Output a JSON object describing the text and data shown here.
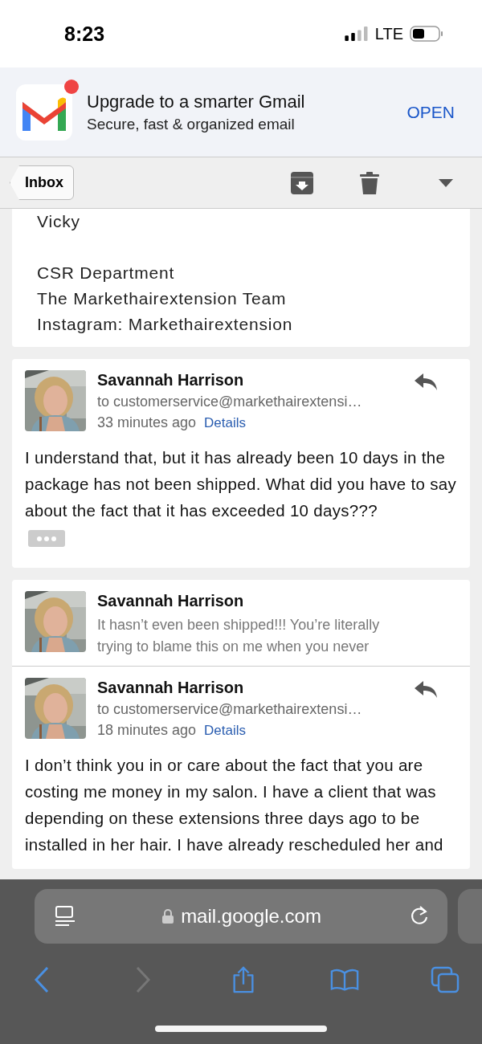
{
  "status_bar": {
    "time": "8:23",
    "network": "LTE"
  },
  "banner": {
    "title": "Upgrade to a smarter Gmail",
    "subtitle": "Secure, fast & organized email",
    "action": "OPEN",
    "notification_dot": true
  },
  "toolbar": {
    "back": "Inbox"
  },
  "signature": {
    "name": "Vicky",
    "lines": [
      "CSR Department",
      "The Markethairextension Team",
      "Instagram: Markethairextension"
    ]
  },
  "cards": [
    {
      "messages": [
        {
          "kind": "expanded",
          "sender": "Savannah Harrison",
          "to": "to customerservice@markethairextensi…",
          "time": "33 minutes ago",
          "details": "Details",
          "body": "I understand that, but it has already been 10 days in the package has not been shipped. What did you have to say about the fact that it has exceeded 10 days???",
          "trimmed": true
        }
      ]
    },
    {
      "messages": [
        {
          "kind": "collapsed",
          "sender": "Savannah Harrison",
          "snippet": "It hasn’t even been shipped!!! You’re literally trying to blame this on me when you never"
        },
        {
          "kind": "expanded",
          "sender": "Savannah Harrison",
          "to": "to customerservice@markethairextensi…",
          "time": "18 minutes ago",
          "details": "Details",
          "body": "I don’t think you in or care about the fact that you are costing me money in my salon. I have a client that was depending on these extensions three days ago to be installed in her hair. I have already rescheduled her and",
          "trimmed": false
        }
      ]
    }
  ],
  "address_bar": {
    "url": "mail.google.com"
  },
  "nav_buttons": [
    {
      "kind": "back",
      "disabled": false
    },
    {
      "kind": "forward",
      "disabled": true
    },
    {
      "kind": "share",
      "disabled": false
    },
    {
      "kind": "bookmarks",
      "disabled": false
    },
    {
      "kind": "tabs",
      "disabled": false
    }
  ]
}
